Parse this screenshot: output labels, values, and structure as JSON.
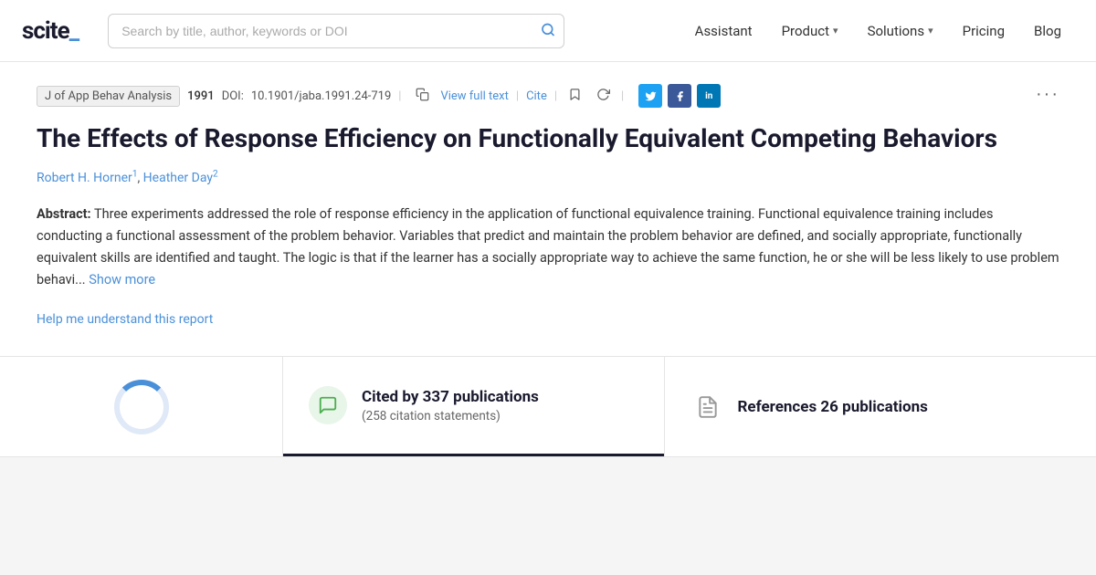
{
  "navbar": {
    "logo_text": "scite_",
    "search_placeholder": "Search by title, author, keywords or DOI",
    "nav_items": [
      {
        "label": "Assistant",
        "has_dropdown": false
      },
      {
        "label": "Product",
        "has_dropdown": true
      },
      {
        "label": "Solutions",
        "has_dropdown": true
      },
      {
        "label": "Pricing",
        "has_dropdown": false
      },
      {
        "label": "Blog",
        "has_dropdown": false
      }
    ]
  },
  "paper": {
    "journal": "J of App Behav Analysis",
    "year": "1991",
    "doi_label": "DOI:",
    "doi_value": "10.1901/jaba.1991.24-719",
    "view_full_text": "View full text",
    "cite_label": "Cite",
    "title": "The Effects of Response Efficiency on Functionally Equivalent Competing Behaviors",
    "authors": [
      {
        "name": "Robert H. Horner",
        "sup": "1"
      },
      {
        "name": "Heather Day",
        "sup": "2"
      }
    ],
    "abstract_label": "Abstract:",
    "abstract_text": "Three experiments addressed the role of response efficiency in the application of functional equivalence training. Functional equivalence training includes conducting a functional assessment of the problem behavior. Variables that predict and maintain the problem behavior are defined, and socially appropriate, functionally equivalent skills are identified and taught. The logic is that if the learner has a socially appropriate way to achieve the same function, he or she will be less likely to use problem behavi...",
    "show_more_label": "Show more",
    "help_link": "Help me understand this report",
    "more_options": "···",
    "social": {
      "twitter": "t",
      "facebook": "f",
      "linkedin": "in"
    }
  },
  "citations": {
    "cited_by_count": "337",
    "cited_by_label": "Cited by",
    "publications_label": "publications",
    "citation_statements_label": "(258 citation statements)",
    "references_label": "References 26 publications"
  },
  "icons": {
    "search": "🔍",
    "refresh": "↻",
    "copy": "⧉",
    "chat": "💬",
    "document": "📄"
  }
}
